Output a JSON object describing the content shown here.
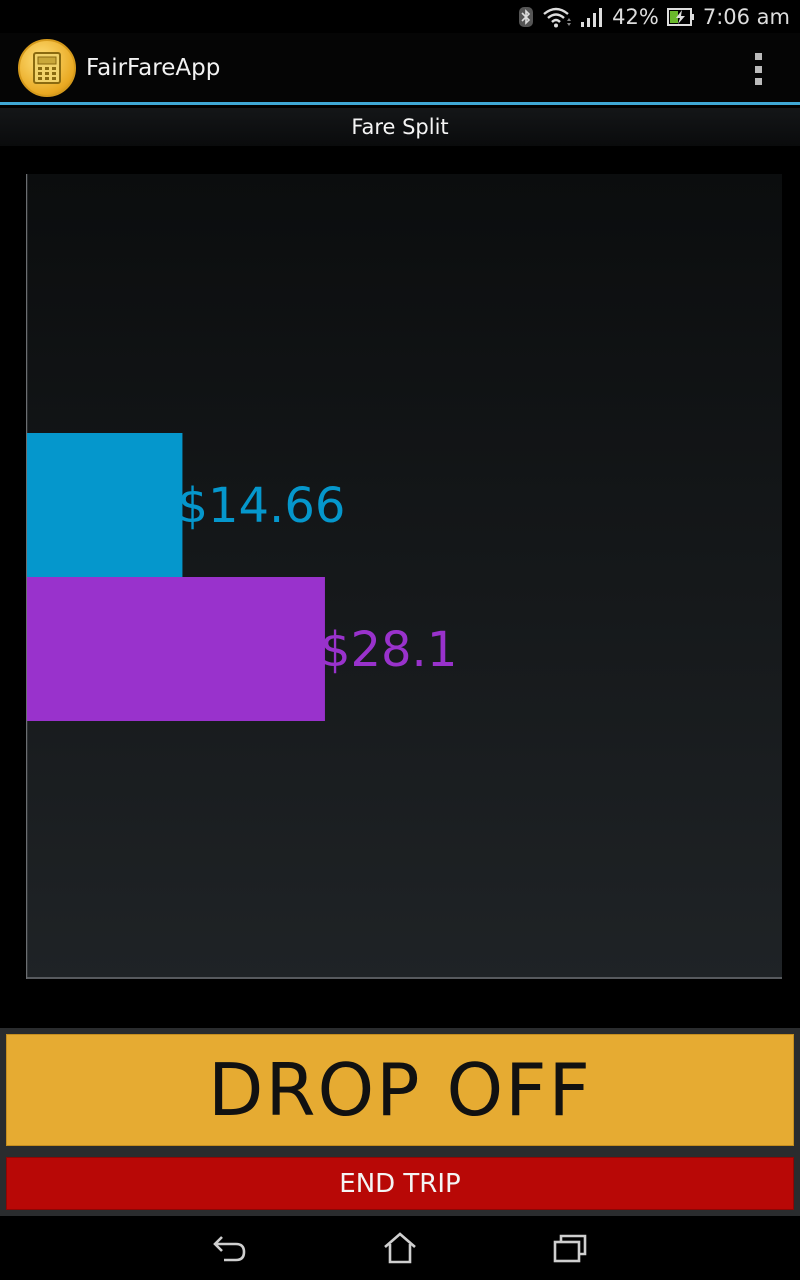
{
  "status_bar": {
    "battery_percent": "42%",
    "time": "7:06 am",
    "icons": [
      "bluetooth-icon",
      "wifi-icon",
      "signal-icon",
      "battery-charging-icon"
    ]
  },
  "action_bar": {
    "title": "FairFareApp",
    "app_icon": "calculator-icon",
    "menu_icon": "overflow-menu-icon"
  },
  "subtitle": "Fare Split",
  "chart_data": {
    "type": "bar",
    "orientation": "horizontal",
    "categories": [
      "",
      ""
    ],
    "values": [
      14.66,
      28.1
    ],
    "value_labels": [
      "$14.66",
      "$28.1"
    ],
    "colors": [
      "#0597cc",
      "#9932cc"
    ],
    "xlim": [
      0,
      71.3
    ],
    "grid": false
  },
  "buttons": {
    "drop_off": "DROP OFF",
    "end_trip": "END TRIP"
  },
  "nav_bar": {
    "icons": [
      "back-icon",
      "home-icon",
      "recent-apps-icon"
    ]
  },
  "colors": {
    "accent": "#3fa8d6",
    "drop_off_bg": "#e6ab32",
    "end_trip_bg": "#b80806"
  }
}
